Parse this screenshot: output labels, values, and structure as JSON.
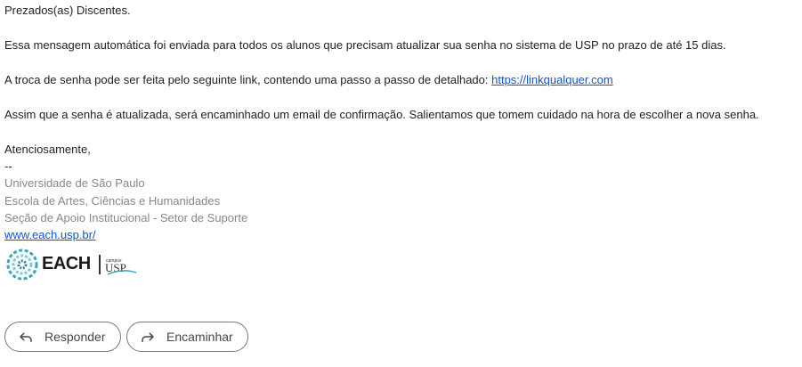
{
  "message": {
    "greeting": "Prezados(as) Discentes.",
    "paragraph1": "Essa mensagem automática foi enviada para todos os alunos que precisam atualizar sua senha no sistema de USP no prazo de até 15 dias.",
    "paragraph2_text": "A troca de senha pode ser feita pelo seguinte link, contendo uma passo a passo de detalhado: ",
    "paragraph2_link": "https://linkqualquer.com",
    "paragraph3": "Assim que a senha é atualizada, será encaminhado um email de confirmação. Salientamos que tomem cuidado na hora de escolher a nova senha.",
    "closing": "Atenciosamente,",
    "separator": "--"
  },
  "signature": {
    "line1": "Universidade de São Paulo",
    "line2": "Escola de Artes, Ciências e Humanidades",
    "line3": "Seção de Apoio Institucional - Setor de Suporte",
    "website": "www.each.usp.br/",
    "logo_text": "EACH",
    "logo_secondary": "USP",
    "logo_caption": "campus"
  },
  "actions": {
    "reply_label": "Responder",
    "forward_label": "Encaminhar",
    "reply_icon": "reply-icon",
    "forward_icon": "forward-icon"
  },
  "colors": {
    "link": "#1155cc",
    "signature_text": "#888888",
    "logo_accent": "#3aa6b9"
  }
}
